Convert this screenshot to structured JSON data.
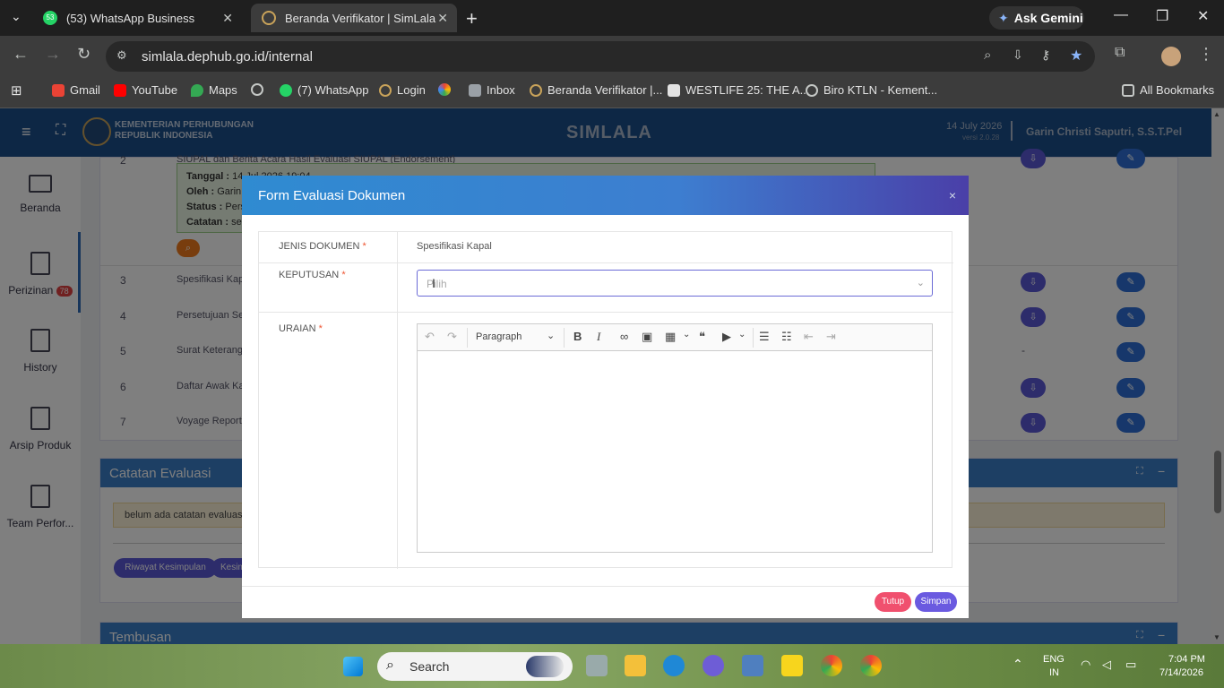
{
  "browser": {
    "tabs": [
      {
        "title": "(53) WhatsApp Business",
        "badge": "53"
      },
      {
        "title": "Beranda Verifikator | SimLala"
      }
    ],
    "ask_gemini": "Ask Gemini",
    "url": "simlala.dephub.go.id/internal",
    "bookmarks": [
      "Gmail",
      "YouTube",
      "Maps",
      "(7) WhatsApp",
      "Login",
      "Inbox",
      "Beranda Verifikator |...",
      "WESTLIFE 25: THE A...",
      "Biro KTLN - Kement..."
    ],
    "all_bookmarks": "All Bookmarks",
    "whatsapp_badge": "53"
  },
  "app": {
    "ministry_line1": "KEMENTERIAN PERHUBUNGAN",
    "ministry_line2": "REPUBLIK INDONESIA",
    "title": "SIMLALA",
    "date": "14 July 2026",
    "version": "versi 2.0.28",
    "user": "Garin Christi Saputri, S.S.T.Pel"
  },
  "sidebar": {
    "items": [
      {
        "label": "Beranda"
      },
      {
        "label": "Perizinan",
        "badge": "78"
      },
      {
        "label": "History"
      },
      {
        "label": "Arsip Produk"
      },
      {
        "label": "Team Perfor..."
      }
    ]
  },
  "background": {
    "row2_title": "SIUPAL dan Berita Acara Hasil Evaluasi SIUPAL (Endorsement)",
    "row2_number": "2",
    "note": {
      "tanggal_label": "Tanggal :",
      "tanggal": "14 Jul 2026 19:04",
      "oleh_label": "Oleh :",
      "oleh": "Garin",
      "status_label": "Status :",
      "status": "Pers",
      "catatan_label": "Catatan :",
      "catatan": "ses"
    },
    "rows": [
      {
        "no": "3",
        "name": "Spesifikasi Kapa"
      },
      {
        "no": "4",
        "name": "Persetujuan Seb"
      },
      {
        "no": "5",
        "name": "Surat Keteranga",
        "dash": "-"
      },
      {
        "no": "6",
        "name": "Daftar Awak Kap"
      },
      {
        "no": "7",
        "name": "Voyage Report ("
      }
    ],
    "catatan_title": "Catatan Evaluasi",
    "catatan_empty": "belum ada catatan evaluasi",
    "riwayat_btn": "Riwayat Kesimpulan",
    "kesim_btn": "Kesim",
    "tembusan_title": "Tembusan"
  },
  "modal": {
    "title": "Form Evaluasi Dokumen",
    "close": "×",
    "jenis_label": "JENIS DOKUMEN",
    "jenis_value": "Spesifikasi Kapal",
    "keputusan_label": "KEPUTUSAN",
    "keputusan_placeholder": "Pilih",
    "uraian_label": "URAIAN",
    "required_mark": "*",
    "paragraph": "Paragraph",
    "tutup": "Tutup",
    "simpan": "Simpan"
  },
  "taskbar": {
    "search": "Search",
    "lang1": "ENG",
    "lang2": "IN",
    "time": "7:04 PM",
    "date": "7/14/2026"
  },
  "colors": {
    "header_blue": "#1a4f8b",
    "modal_gradient_start": "#2f8bd1",
    "modal_gradient_end": "#4a3fa8",
    "tutup": "#f0506e",
    "simpan": "#6a5ae0",
    "download_btn": "#5b58d6",
    "edit_btn": "#2e6fd6"
  }
}
